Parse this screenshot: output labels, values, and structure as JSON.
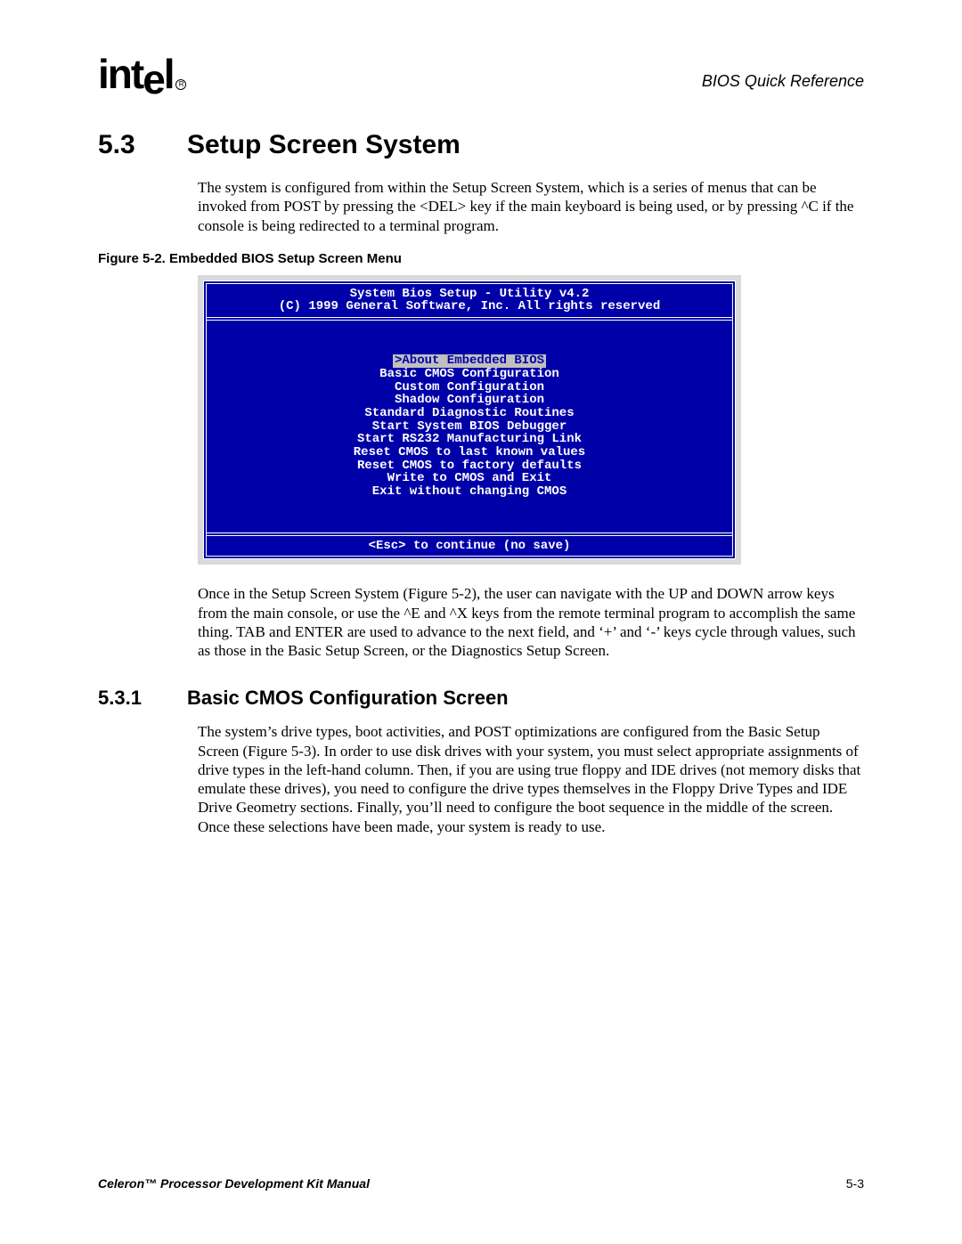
{
  "header": {
    "logo_text": "int",
    "logo_text2": "e",
    "logo_text3": "l",
    "right": "BIOS Quick Reference"
  },
  "section": {
    "number": "5.3",
    "title": "Setup Screen System",
    "para1": "The system is configured from within the Setup Screen System, which is a series of menus that can be invoked from POST by pressing the <DEL> key if the main keyboard is being used, or by pressing ^C if the console is being redirected to a terminal program.",
    "fig_caption": "Figure 5-2. Embedded BIOS Setup Screen Menu",
    "para2": "Once in the Setup Screen System (Figure 5-2), the user can navigate with the UP and DOWN arrow keys from the main console, or use the ^E and ^X keys from the remote terminal program to accomplish the same thing. TAB and ENTER are used to advance to the next field, and ‘+’ and ‘-’ keys cycle through values, such as those in the Basic Setup Screen, or the Diagnostics Setup Screen."
  },
  "bios": {
    "title1": "System Bios Setup - Utility v4.2",
    "title2": "(C) 1999 General Software, Inc. All rights reserved",
    "items": [
      ">About Embedded BIOS ",
      "Basic CMOS Configuration",
      "Custom Configuration",
      "Shadow Configuration",
      "Standard Diagnostic Routines",
      "Start System BIOS Debugger",
      "Start RS232 Manufacturing Link",
      "Reset CMOS to last known values",
      "Reset CMOS to factory defaults",
      "Write to CMOS and Exit",
      "Exit without changing CMOS"
    ],
    "selected_index": 0,
    "footer": "<Esc> to continue (no save)"
  },
  "subsection": {
    "number": "5.3.1",
    "title": "Basic CMOS Configuration Screen",
    "para": "The system’s drive types, boot activities, and POST optimizations are configured from the Basic Setup Screen (Figure 5-3). In order to use disk drives with your system, you must select appropriate assignments of drive types in the left-hand column. Then, if you are using true floppy and IDE drives (not memory disks that emulate these drives), you need to configure the drive types themselves in the Floppy Drive Types and IDE Drive Geometry sections. Finally, you’ll need to configure the boot sequence in the middle of the screen. Once these selections have been made, your system is ready to use."
  },
  "footer": {
    "left": "Celeron™ Processor Development Kit Manual",
    "right": "5-3"
  }
}
